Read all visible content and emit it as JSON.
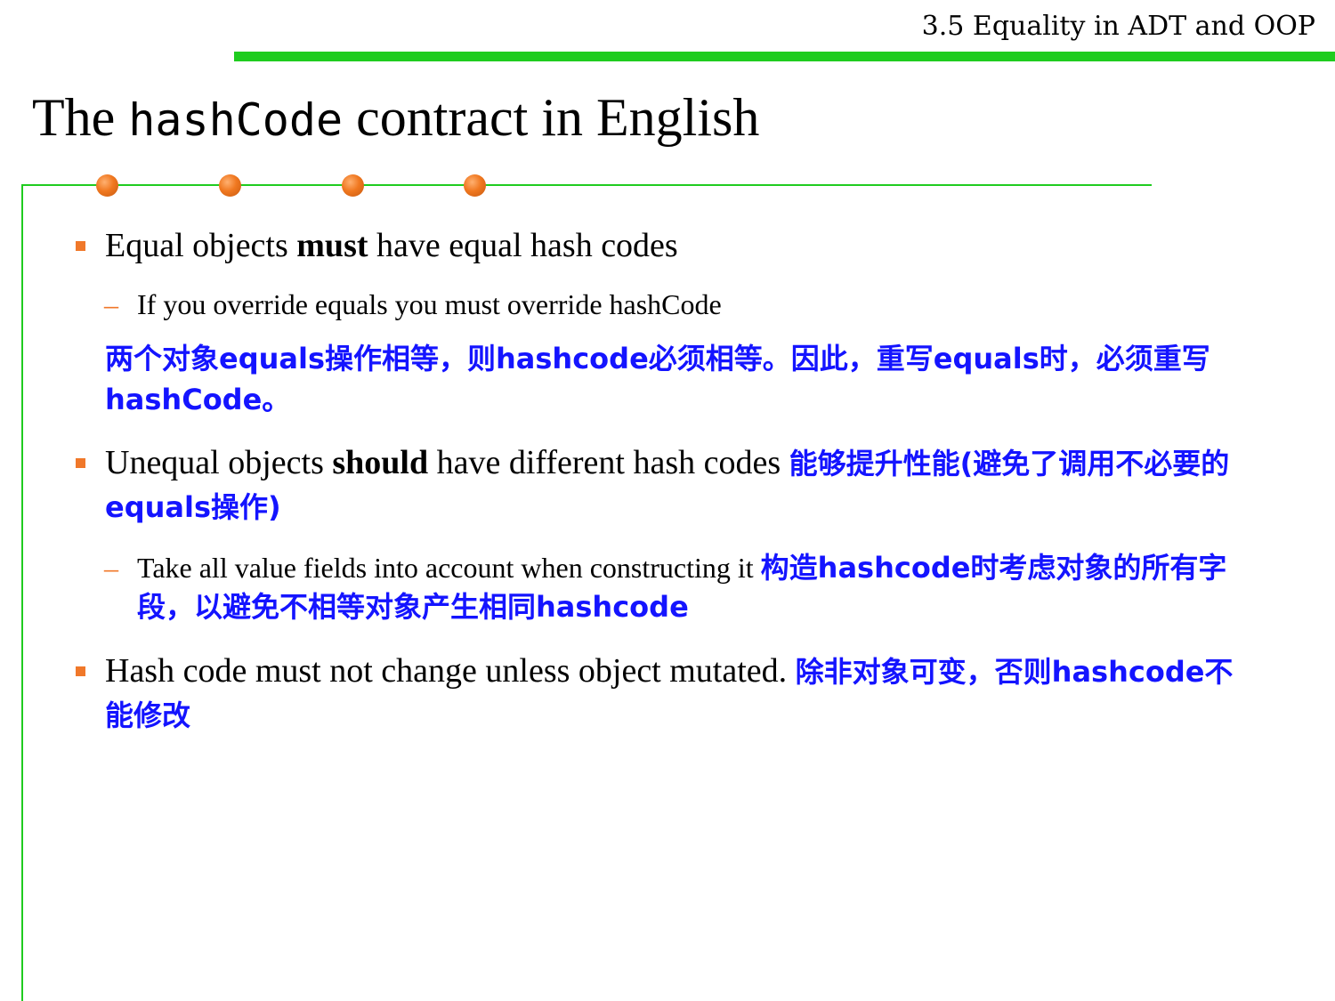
{
  "header": {
    "section_title": "3.5 Equality in ADT and OOP"
  },
  "slide": {
    "title_pre": "The ",
    "title_code": "hashCode",
    "title_post": " contract in English"
  },
  "bullets": [
    {
      "pre": "Equal objects ",
      "bold": "must",
      "post": " have equal hash codes",
      "sub": "If you override equals you must override hashCode",
      "note": "两个对象equals操作相等，则hashcode必须相等。因此，重写equals时，必须重写hashCode。"
    },
    {
      "pre": "Unequal objects ",
      "bold": "should",
      "post": " have different hash codes ",
      "inline_note": "能够提升性能(避免了调用不必要的equals操作)",
      "sub": "Take all value fields into account when constructing it ",
      "sub_note": "构造hashcode时考虑对象的所有字段，以避免不相等对象产生相同hashcode"
    },
    {
      "text": "Hash code must not change unless object mutated. ",
      "inline_note": "除非对象可变，否则hashcode不能修改"
    }
  ],
  "colors": {
    "accent_green": "#1fcc1f",
    "bullet_orange": "#f0782a",
    "note_blue": "#1414ff"
  }
}
